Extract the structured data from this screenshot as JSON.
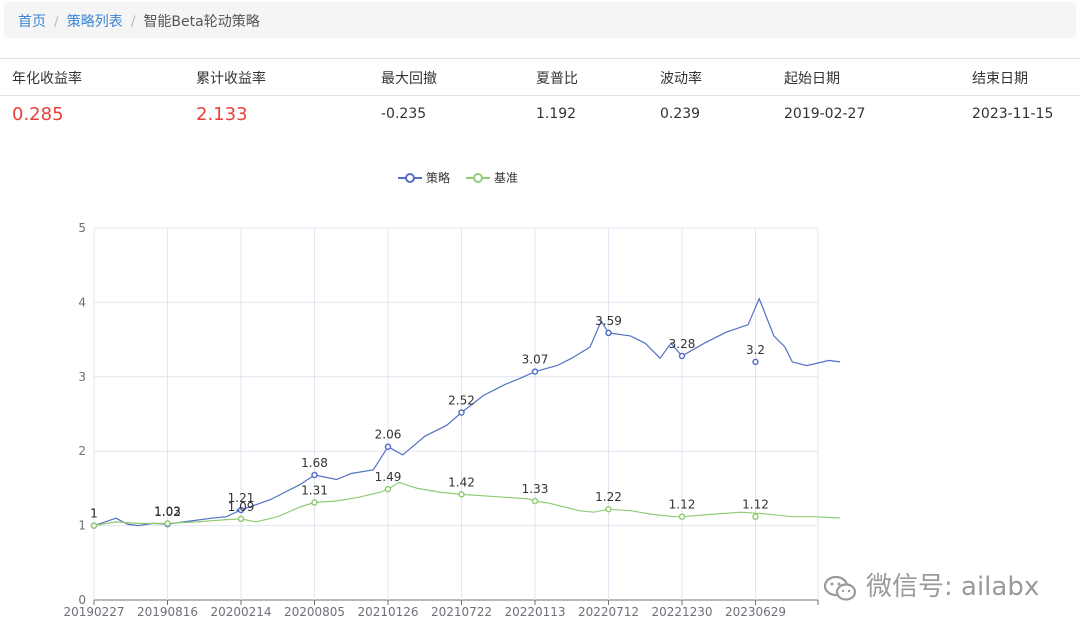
{
  "breadcrumb": {
    "home": "首页",
    "list": "策略列表",
    "current": "智能Beta轮动策略"
  },
  "stats": [
    {
      "label": "年化收益率",
      "value": "0.285",
      "highlight": true
    },
    {
      "label": "累计收益率",
      "value": "2.133",
      "highlight": true
    },
    {
      "label": "最大回撤",
      "value": "-0.235",
      "highlight": false
    },
    {
      "label": "夏普比",
      "value": "1.192",
      "highlight": false
    },
    {
      "label": "波动率",
      "value": "0.239",
      "highlight": false
    },
    {
      "label": "起始日期",
      "value": "2019-02-27",
      "highlight": false
    },
    {
      "label": "结束日期",
      "value": "2023-11-15",
      "highlight": false
    }
  ],
  "watermark": "微信号: ailabx",
  "colors": {
    "strategy": "#5470c6",
    "benchmark": "#91cc75",
    "highlight": "#e8413c",
    "link": "#3c86d6"
  },
  "chart_data": {
    "type": "line",
    "legend_position": "top-center",
    "grid": true,
    "ylim": [
      0,
      5
    ],
    "yticks": [
      "0",
      "1",
      "2",
      "3",
      "4",
      "5"
    ],
    "xticks": [
      "20190227",
      "20190816",
      "20200214",
      "20200805",
      "20210126",
      "20210722",
      "20220113",
      "20220712",
      "20221230",
      "20230629"
    ],
    "series": [
      {
        "name": "策略",
        "labels": [
          "1",
          "1.02",
          "1.21",
          "1.68",
          "2.06",
          "2.52",
          "3.07",
          "3.59",
          "3.28",
          "3.2"
        ],
        "values": [
          1,
          1.02,
          1.21,
          1.68,
          2.06,
          2.52,
          3.07,
          3.59,
          3.28,
          3.2
        ],
        "path": [
          [
            0,
            1.0
          ],
          [
            0.15,
            1.05
          ],
          [
            0.3,
            1.1
          ],
          [
            0.45,
            1.02
          ],
          [
            0.6,
            1.0
          ],
          [
            0.8,
            1.03
          ],
          [
            1,
            1.02
          ],
          [
            1.3,
            1.06
          ],
          [
            1.6,
            1.1
          ],
          [
            1.8,
            1.12
          ],
          [
            2,
            1.21
          ],
          [
            2.2,
            1.28
          ],
          [
            2.4,
            1.35
          ],
          [
            2.6,
            1.45
          ],
          [
            2.8,
            1.55
          ],
          [
            3,
            1.68
          ],
          [
            3.3,
            1.62
          ],
          [
            3.5,
            1.7
          ],
          [
            3.8,
            1.75
          ],
          [
            4,
            2.06
          ],
          [
            4.2,
            1.95
          ],
          [
            4.5,
            2.2
          ],
          [
            4.8,
            2.35
          ],
          [
            5,
            2.52
          ],
          [
            5.3,
            2.75
          ],
          [
            5.6,
            2.9
          ],
          [
            5.8,
            2.98
          ],
          [
            6,
            3.07
          ],
          [
            6.3,
            3.15
          ],
          [
            6.5,
            3.25
          ],
          [
            6.75,
            3.4
          ],
          [
            6.9,
            3.75
          ],
          [
            7,
            3.59
          ],
          [
            7.3,
            3.55
          ],
          [
            7.5,
            3.45
          ],
          [
            7.7,
            3.25
          ],
          [
            7.85,
            3.45
          ],
          [
            8,
            3.28
          ],
          [
            8.3,
            3.45
          ],
          [
            8.6,
            3.6
          ],
          [
            8.9,
            3.7
          ],
          [
            9.05,
            4.05
          ],
          [
            9.25,
            3.55
          ],
          [
            9.4,
            3.4
          ],
          [
            9.5,
            3.2
          ],
          [
            9.7,
            3.15
          ],
          [
            10,
            3.22
          ],
          [
            10.3,
            3.18
          ],
          [
            10.6,
            3.15
          ],
          [
            10.85,
            3.12
          ]
        ]
      },
      {
        "name": "基准",
        "labels": [
          "1",
          "1.03",
          "1.09",
          "1.31",
          "1.49",
          "1.42",
          "1.33",
          "1.22",
          "1.12",
          "1.12"
        ],
        "values": [
          1,
          1.03,
          1.09,
          1.31,
          1.49,
          1.42,
          1.33,
          1.22,
          1.12,
          1.12
        ],
        "path": [
          [
            0,
            1.0
          ],
          [
            0.3,
            1.05
          ],
          [
            0.6,
            1.03
          ],
          [
            1,
            1.03
          ],
          [
            1.4,
            1.05
          ],
          [
            1.8,
            1.08
          ],
          [
            2,
            1.09
          ],
          [
            2.2,
            1.05
          ],
          [
            2.5,
            1.12
          ],
          [
            2.8,
            1.25
          ],
          [
            3,
            1.31
          ],
          [
            3.3,
            1.33
          ],
          [
            3.6,
            1.38
          ],
          [
            3.9,
            1.45
          ],
          [
            4,
            1.49
          ],
          [
            4.15,
            1.58
          ],
          [
            4.4,
            1.5
          ],
          [
            4.7,
            1.45
          ],
          [
            5,
            1.42
          ],
          [
            5.3,
            1.4
          ],
          [
            5.6,
            1.38
          ],
          [
            5.9,
            1.36
          ],
          [
            6,
            1.33
          ],
          [
            6.2,
            1.3
          ],
          [
            6.4,
            1.25
          ],
          [
            6.6,
            1.2
          ],
          [
            6.8,
            1.18
          ],
          [
            7,
            1.22
          ],
          [
            7.3,
            1.2
          ],
          [
            7.6,
            1.15
          ],
          [
            7.9,
            1.12
          ],
          [
            8,
            1.12
          ],
          [
            8.4,
            1.15
          ],
          [
            8.8,
            1.18
          ],
          [
            9.1,
            1.16
          ],
          [
            9.5,
            1.12
          ],
          [
            9.8,
            1.12
          ],
          [
            10.2,
            1.1
          ],
          [
            10.6,
            1.08
          ],
          [
            10.85,
            1.06
          ]
        ]
      }
    ]
  }
}
